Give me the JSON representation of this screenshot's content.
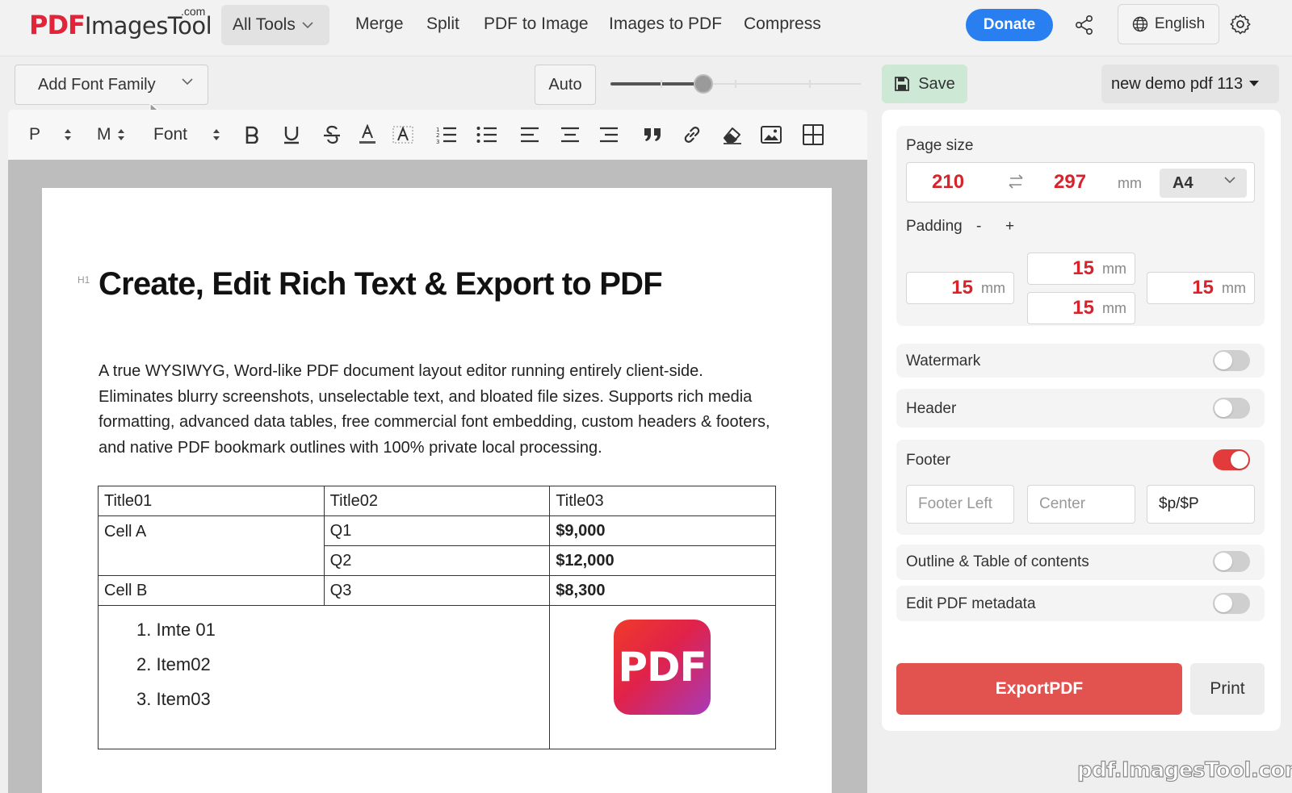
{
  "brand": {
    "logo_pdf": "PDF",
    "logo_rest": "ImagesTool",
    "logo_com": ".com"
  },
  "nav": {
    "all_tools": "All Tools",
    "links": [
      "Merge",
      "Split",
      "PDF to Image",
      "Images to PDF",
      "Compress"
    ],
    "donate": "Donate",
    "language": "English"
  },
  "toolbar": {
    "font_family": "Add Font Family",
    "auto": "Auto",
    "zoom_percent": 37
  },
  "format_bar": {
    "paragraph": "P",
    "size": "M",
    "font": "Font"
  },
  "document": {
    "heading_tag": "H1",
    "title": "Create, Edit Rich Text & Export to PDF",
    "paragraph": "A true WYSIWYG, Word-like PDF document layout editor running entirely client-side. Eliminates blurry screenshots, unselectable text, and bloated file sizes. Supports rich media formatting, advanced data tables, free commercial font embedding, custom headers & footers, and native PDF bookmark outlines with 100% private local processing.",
    "table": {
      "headers": [
        "Title01",
        "Title02",
        "Title03"
      ],
      "rows": [
        {
          "a": "Cell A",
          "b": "Q1",
          "c": "$9,000"
        },
        {
          "b": "Q2",
          "c": "$12,000"
        },
        {
          "a": "Cell B",
          "b": "Q3",
          "c": "$8,300"
        }
      ],
      "list": [
        "1. Imte 01",
        "2. Item02",
        "3. Item03"
      ],
      "image_label": "PDF"
    }
  },
  "panel": {
    "save": "Save",
    "doc_name": "new demo pdf 113",
    "page_size": {
      "label": "Page size",
      "width": "210",
      "height": "297",
      "unit": "mm",
      "format": "A4"
    },
    "padding": {
      "label": "Padding",
      "minus": "-",
      "plus": "+",
      "top": "15",
      "left": "15",
      "right": "15",
      "bottom": "15",
      "unit": "mm"
    },
    "watermark": {
      "label": "Watermark",
      "on": false
    },
    "header": {
      "label": "Header",
      "on": false
    },
    "footer": {
      "label": "Footer",
      "on": true,
      "left_placeholder": "Footer Left",
      "center_placeholder": "Center",
      "right_value": "$p/$P"
    },
    "outline": {
      "label": "Outline & Table of contents",
      "on": false
    },
    "metadata": {
      "label": "Edit PDF metadata",
      "on": false
    },
    "export": "ExportPDF",
    "print": "Print"
  },
  "watermark_text": "pdf.ImagesTool.com",
  "colors": {
    "brand_red": "#e2243b",
    "donate_blue": "#2a7ff0",
    "export_red": "#e2524f",
    "toggle_on": "#e33b3b",
    "save_green": "#cde9d6"
  }
}
